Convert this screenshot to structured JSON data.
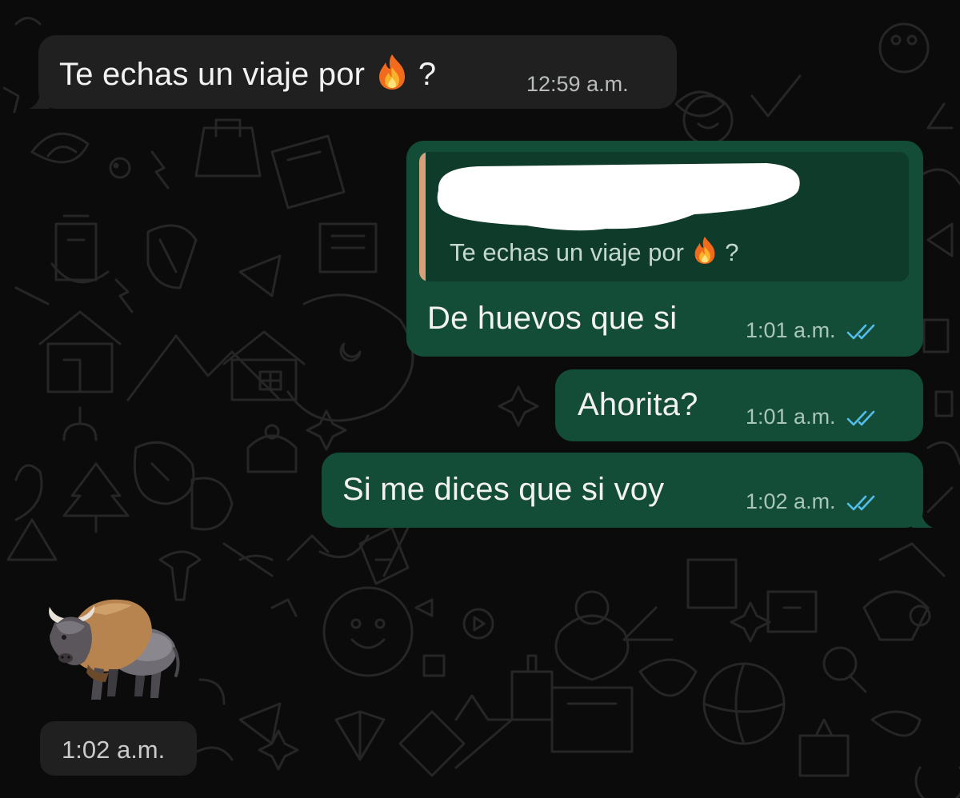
{
  "wallpaper": {
    "style": "doodle-pattern",
    "background": "#0b0b0b",
    "stroke": "#2a2a2a"
  },
  "colors": {
    "incoming_bubble": "#202021",
    "outgoing_bubble": "#144d37",
    "quote_accent": "#d6a07a",
    "read_ticks": "#53bdeb"
  },
  "messages": [
    {
      "direction": "incoming",
      "text": "Te echas un viaje por",
      "emoji": "fire-icon",
      "suffix": "?",
      "time": "12:59 a.m."
    },
    {
      "direction": "outgoing",
      "reply_quote": {
        "author": "[redacted]",
        "text": "Te echas un viaje por",
        "emoji": "fire-icon",
        "suffix": "?"
      },
      "text": "De huevos que si",
      "time": "1:01 a.m.",
      "status": "read"
    },
    {
      "direction": "outgoing",
      "text": "Ahorita?",
      "time": "1:01 a.m.",
      "status": "read"
    },
    {
      "direction": "outgoing",
      "text": "Si me dices que si voy",
      "time": "1:02 a.m.",
      "status": "read"
    },
    {
      "direction": "incoming",
      "sticker": "bison-icon",
      "time": "1:02 a.m."
    }
  ]
}
